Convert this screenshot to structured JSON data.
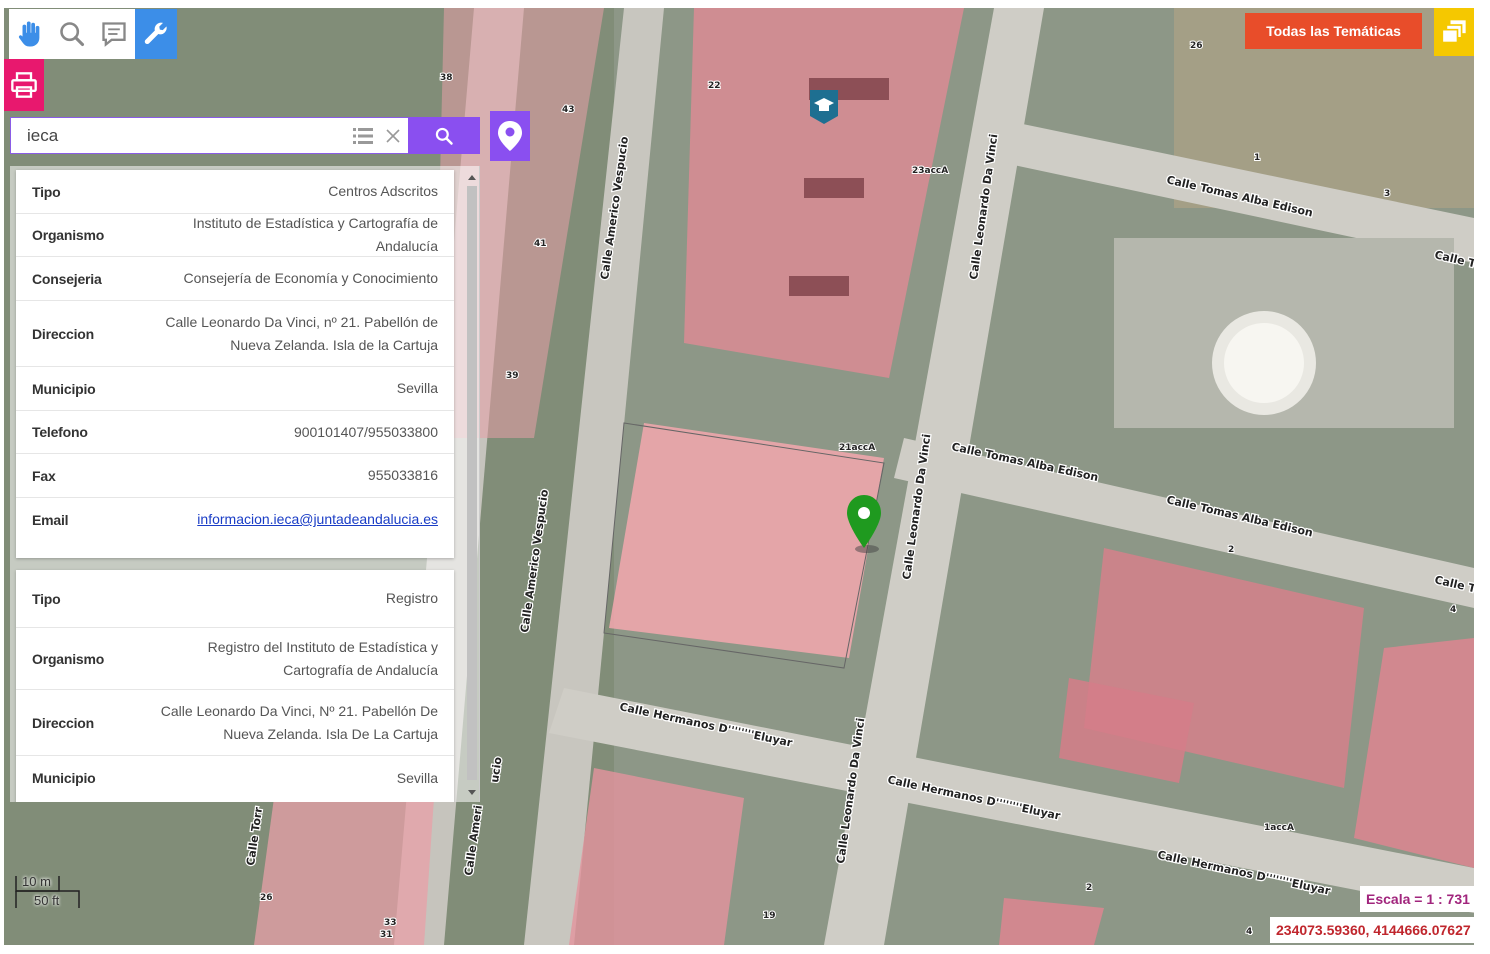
{
  "toolbar": {
    "tools": [
      {
        "name": "pan-tool",
        "icon": "hand-icon"
      },
      {
        "name": "zoom-tool",
        "icon": "magnifier-icon"
      },
      {
        "name": "info-tool",
        "icon": "comment-icon"
      },
      {
        "name": "settings-tool",
        "icon": "wrench-icon",
        "active": true
      }
    ],
    "print_icon": "printer-icon"
  },
  "search": {
    "value": "ieca",
    "list_icon": "list-icon",
    "clear_icon": "close-icon",
    "submit_icon": "search-icon",
    "locate_icon": "map-pin-icon"
  },
  "results": [
    {
      "rows": [
        {
          "key": "Tipo",
          "value": "Centros Adscritos"
        },
        {
          "key": "Organismo",
          "value": "Instituto de Estadística y Cartografía de Andalucía"
        },
        {
          "key": "Consejeria",
          "value": "Consejería de Economía y Conocimiento"
        },
        {
          "key": "Direccion",
          "value": "Calle Leonardo Da Vinci, nº 21. Pabellón de Nueva Zelanda. Isla de la Cartuja"
        },
        {
          "key": "Municipio",
          "value": "Sevilla"
        },
        {
          "key": "Telefono",
          "value": "900101407/955033800"
        },
        {
          "key": "Fax",
          "value": "955033816"
        },
        {
          "key": "Email",
          "value": "informacion.ieca@juntadeandalucia.es"
        }
      ]
    },
    {
      "rows": [
        {
          "key": "Tipo",
          "value": "Registro"
        },
        {
          "key": "Organismo",
          "value": "Registro del Instituto de Estadística y Cartografía de Andalucía"
        },
        {
          "key": "Direccion",
          "value": "Calle Leonardo Da Vinci, Nº 21. Pabellón De Nueva Zelanda. Isla De La Cartuja"
        },
        {
          "key": "Municipio",
          "value": "Sevilla"
        }
      ]
    }
  ],
  "map": {
    "streets": [
      "Calle Americo Vespucio",
      "Calle Leonardo Da Vinci",
      "Calle Tomas Alba Edison",
      "Calle Hermanos D''''''''Eluyar",
      "Calle To",
      "Calle Torr",
      "Calle Ameri",
      "ucio"
    ],
    "house_numbers": [
      "26",
      "38",
      "43",
      "22",
      "23accA",
      "41",
      "39",
      "21accA",
      "1",
      "3",
      "2",
      "4",
      "1accA",
      "26",
      "33",
      "31",
      "19",
      "2",
      "4"
    ],
    "marker_icon": "location-marker-icon",
    "poi_icon": "education-icon",
    "colors": {
      "building": "#e58a95",
      "highlight": "#8a4ff0",
      "marker": "#1f9a1f"
    }
  },
  "themes_button": {
    "label": "Todas las Temáticas",
    "icon": "map-icon"
  },
  "layers_icon": "layers-icon",
  "scale": {
    "metric": "10 m",
    "imperial": "50 ft",
    "ratio": "Escala = 1 : 731"
  },
  "coordinates": "234073.59360, 4144666.07627"
}
